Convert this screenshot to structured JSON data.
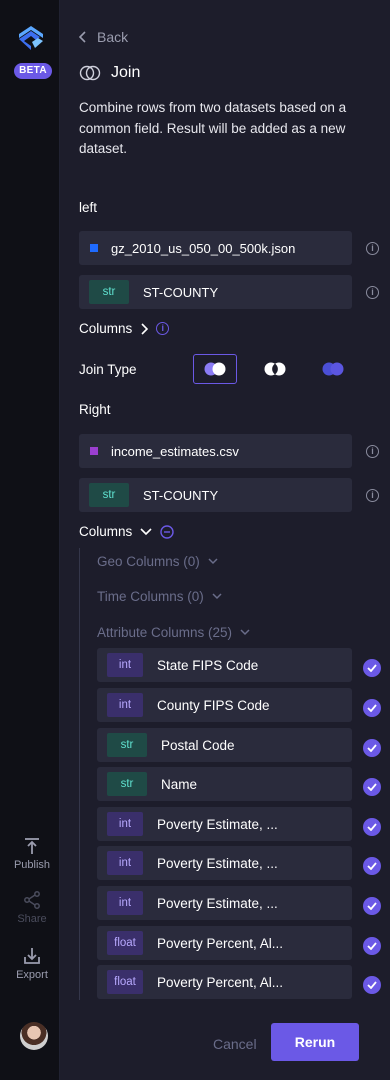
{
  "sidebar": {
    "badge": "BETA",
    "items": [
      {
        "label": "Publish",
        "icon": "publish-icon"
      },
      {
        "label": "Share",
        "icon": "share-icon"
      },
      {
        "label": "Export",
        "icon": "export-icon"
      }
    ]
  },
  "panel": {
    "back_label": "Back",
    "title": "Join",
    "description": "Combine rows from two datasets based on a common field. Result will be added as a new dataset."
  },
  "left": {
    "section_label": "left",
    "dataset": "gz_2010_us_050_00_500k.json",
    "dataset_color": "#1f6bff",
    "key_type": "str",
    "key_field": "ST-COUNTY",
    "columns_label": "Columns"
  },
  "join": {
    "label": "Join Type",
    "options": [
      "left-join-icon",
      "inner-join-icon",
      "right-join-icon"
    ],
    "selected": "left-join-icon"
  },
  "right": {
    "section_label": "Right",
    "dataset": "income_estimates.csv",
    "dataset_color": "#9b3fd0",
    "key_type": "str",
    "key_field": "ST-COUNTY",
    "columns_label": "Columns",
    "groups": {
      "geo": "Geo Columns (0)",
      "time": "Time Columns (0)",
      "attribute": "Attribute Columns (25)"
    },
    "attributes": [
      {
        "type": "int",
        "name": "State FIPS Code",
        "checked": true
      },
      {
        "type": "int",
        "name": "County FIPS Code",
        "checked": true
      },
      {
        "type": "str",
        "name": "Postal Code",
        "checked": true
      },
      {
        "type": "str",
        "name": "Name",
        "checked": true
      },
      {
        "type": "int",
        "name": "Poverty Estimate, ...",
        "checked": true
      },
      {
        "type": "int",
        "name": "Poverty Estimate, ...",
        "checked": true
      },
      {
        "type": "int",
        "name": "Poverty Estimate, ...",
        "checked": true
      },
      {
        "type": "float",
        "name": "Poverty Percent, Al...",
        "checked": true
      },
      {
        "type": "float",
        "name": "Poverty Percent, Al...",
        "checked": true
      }
    ]
  },
  "footer": {
    "cancel_label": "Cancel",
    "rerun_label": "Rerun"
  },
  "colors": {
    "accent": "#6b59e6",
    "background": "#1d1d2b",
    "field": "#2a2b3c"
  }
}
